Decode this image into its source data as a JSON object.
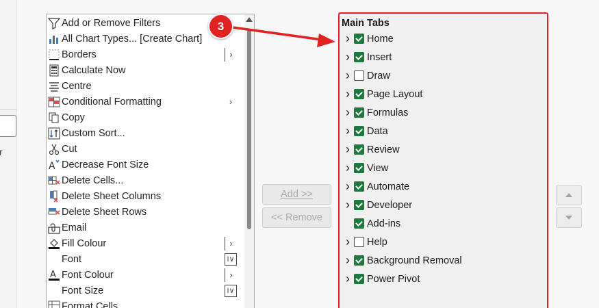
{
  "left_strip": {
    "fragment": "r"
  },
  "commands": [
    {
      "label": "Add or Remove Filters",
      "icon": "filter-icon",
      "indicator": ""
    },
    {
      "label": "All Chart Types... [Create Chart]",
      "icon": "chart-icon",
      "indicator": ""
    },
    {
      "label": "Borders",
      "icon": "borders-icon",
      "indicator": "bar-arrow"
    },
    {
      "label": "Calculate Now",
      "icon": "calculator-icon",
      "indicator": ""
    },
    {
      "label": "Centre",
      "icon": "align-center-icon",
      "indicator": ""
    },
    {
      "label": "Conditional Formatting",
      "icon": "conditional-formatting-icon",
      "indicator": "arrow"
    },
    {
      "label": "Copy",
      "icon": "copy-icon",
      "indicator": ""
    },
    {
      "label": "Custom Sort...",
      "icon": "sort-icon",
      "indicator": ""
    },
    {
      "label": "Cut",
      "icon": "scissors-icon",
      "indicator": ""
    },
    {
      "label": "Decrease Font Size",
      "icon": "decrease-font-icon",
      "indicator": ""
    },
    {
      "label": "Delete Cells...",
      "icon": "delete-cells-icon",
      "indicator": ""
    },
    {
      "label": "Delete Sheet Columns",
      "icon": "delete-columns-icon",
      "indicator": ""
    },
    {
      "label": "Delete Sheet Rows",
      "icon": "delete-rows-icon",
      "indicator": ""
    },
    {
      "label": "Email",
      "icon": "email-icon",
      "indicator": ""
    },
    {
      "label": "Fill Colour",
      "icon": "fill-color-icon",
      "indicator": "bar-arrow"
    },
    {
      "label": "Font",
      "icon": "",
      "indicator": "boxed"
    },
    {
      "label": "Font Colour",
      "icon": "font-color-icon",
      "indicator": "bar-arrow"
    },
    {
      "label": "Font Size",
      "icon": "",
      "indicator": "boxed"
    },
    {
      "label": "Format Cells",
      "icon": "format-cells-icon",
      "indicator": ""
    }
  ],
  "buttons": {
    "add": "Add >>",
    "remove": "<< Remove"
  },
  "tabs_header": "Main Tabs",
  "tabs": [
    {
      "label": "Home",
      "checked": true,
      "expandable": true
    },
    {
      "label": "Insert",
      "checked": true,
      "expandable": true
    },
    {
      "label": "Draw",
      "checked": false,
      "expandable": true
    },
    {
      "label": "Page Layout",
      "checked": true,
      "expandable": true
    },
    {
      "label": "Formulas",
      "checked": true,
      "expandable": true
    },
    {
      "label": "Data",
      "checked": true,
      "expandable": true
    },
    {
      "label": "Review",
      "checked": true,
      "expandable": true
    },
    {
      "label": "View",
      "checked": true,
      "expandable": true
    },
    {
      "label": "Automate",
      "checked": true,
      "expandable": true
    },
    {
      "label": "Developer",
      "checked": true,
      "expandable": true
    },
    {
      "label": "Add-ins",
      "checked": true,
      "expandable": false
    },
    {
      "label": "Help",
      "checked": false,
      "expandable": true
    },
    {
      "label": "Background Removal",
      "checked": true,
      "expandable": true
    },
    {
      "label": "Power Pivot",
      "checked": true,
      "expandable": true
    }
  ],
  "callout": {
    "number": "3"
  },
  "colors": {
    "accent_red": "#e02222",
    "check_green": "#1d7a3e"
  }
}
